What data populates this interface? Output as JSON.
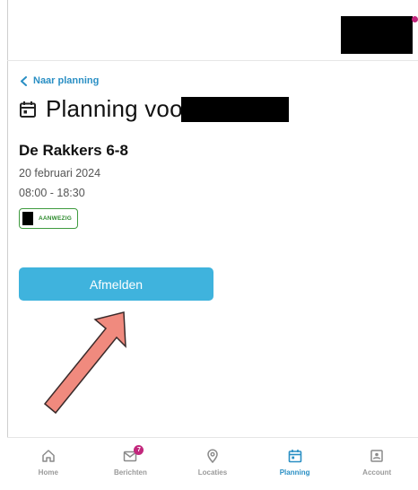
{
  "header": {
    "back_label": "Naar planning",
    "title": "Planning voor",
    "notification_color": "#c2277c"
  },
  "planning": {
    "group_name": "De Rakkers 6-8",
    "date": "20 februari 2024",
    "time": "08:00 - 18:30",
    "status": "AANWEZIG",
    "status_color": "#3f9b3f"
  },
  "actions": {
    "cancel_label": "Afmelden",
    "button_color": "#3fb3dd"
  },
  "bottom_nav": {
    "items": [
      {
        "label": "Home",
        "icon": "home-icon",
        "active": false
      },
      {
        "label": "Berichten",
        "icon": "mail-icon",
        "active": false,
        "badge": "7"
      },
      {
        "label": "Locaties",
        "icon": "location-pin-icon",
        "active": false
      },
      {
        "label": "Planning",
        "icon": "calendar-icon",
        "active": true
      },
      {
        "label": "Account",
        "icon": "account-icon",
        "active": false
      }
    ],
    "active_color": "#2a8fc4"
  },
  "annotation": {
    "arrow_color": "#f08a7e",
    "arrow_target": "cancel-button"
  }
}
